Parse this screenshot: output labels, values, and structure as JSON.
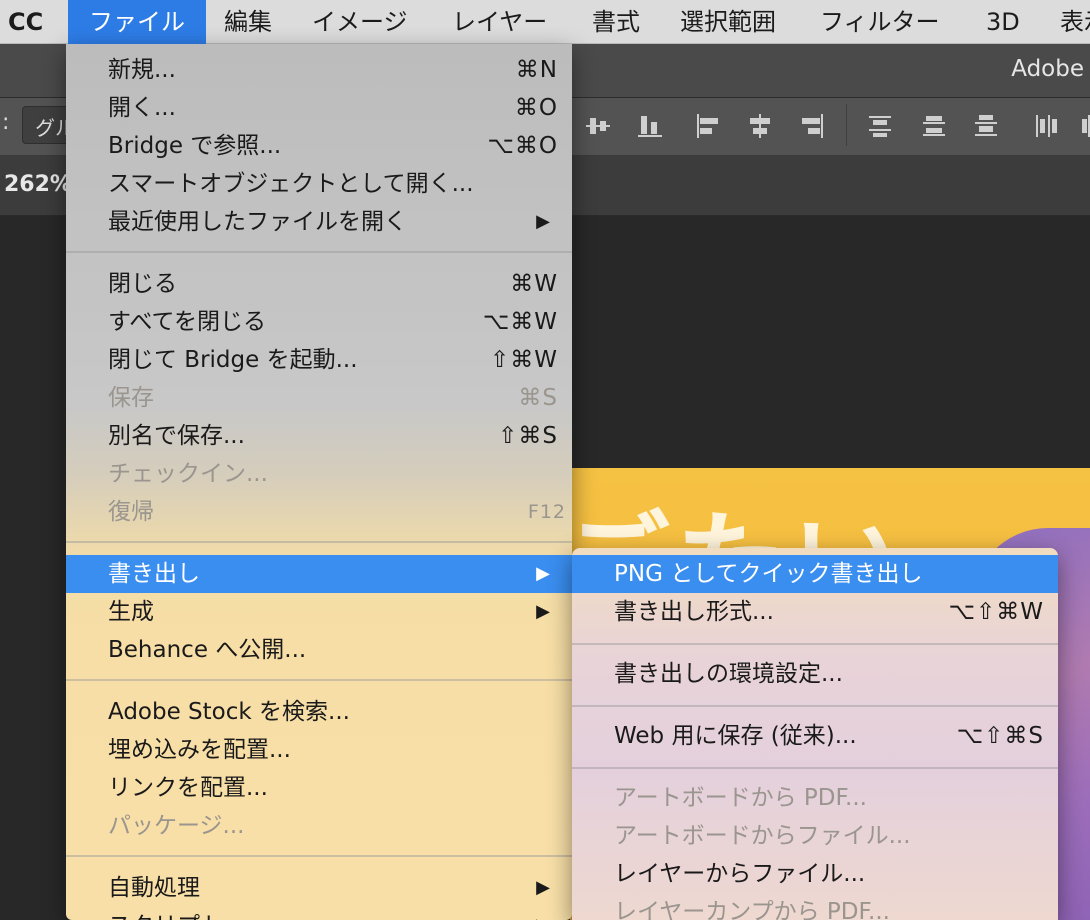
{
  "menubar": {
    "items": [
      "CC",
      "ファイル",
      "編集",
      "イメージ",
      "レイヤー",
      "書式",
      "選択範囲",
      "フィルター",
      "3D",
      "表示"
    ]
  },
  "app": {
    "title": "Adobe"
  },
  "options_bar": {
    "colon": ":",
    "select_value": "グル"
  },
  "tab": {
    "zoom": "262%"
  },
  "artwork": {
    "text": "ごたい"
  },
  "file_menu": {
    "items": [
      {
        "label": "新規...",
        "shortcut": "⌘N"
      },
      {
        "label": "開く...",
        "shortcut": "⌘O"
      },
      {
        "label": "Bridge で参照...",
        "shortcut": "⌥⌘O"
      },
      {
        "label": "スマートオブジェクトとして開く...",
        "shortcut": ""
      },
      {
        "label": "最近使用したファイルを開く",
        "arrow": "▶"
      },
      {
        "label": "閉じる",
        "shortcut": "⌘W"
      },
      {
        "label": "すべてを閉じる",
        "shortcut": "⌥⌘W"
      },
      {
        "label": "閉じて Bridge を起動...",
        "shortcut": "⇧⌘W"
      },
      {
        "label": "保存",
        "shortcut": "⌘S"
      },
      {
        "label": "別名で保存...",
        "shortcut": "⇧⌘S"
      },
      {
        "label": "チェックイン...",
        "shortcut": ""
      },
      {
        "label": "復帰",
        "shortcut": "F12"
      },
      {
        "label": "書き出し",
        "arrow": "▶"
      },
      {
        "label": "生成",
        "arrow": "▶"
      },
      {
        "label": "Behance へ公開...",
        "shortcut": ""
      },
      {
        "label": "Adobe Stock を検索...",
        "shortcut": ""
      },
      {
        "label": "埋め込みを配置...",
        "shortcut": ""
      },
      {
        "label": "リンクを配置...",
        "shortcut": ""
      },
      {
        "label": "パッケージ...",
        "shortcut": ""
      },
      {
        "label": "自動処理",
        "arrow": "▶"
      },
      {
        "label": "スクリプト",
        "arrow": "▶"
      }
    ]
  },
  "export_submenu": {
    "items": [
      {
        "label": "PNG としてクイック書き出し",
        "shortcut": ""
      },
      {
        "label": "書き出し形式...",
        "shortcut": "⌥⇧⌘W"
      },
      {
        "label": "書き出しの環境設定...",
        "shortcut": ""
      },
      {
        "label": "Web 用に保存 (従来)...",
        "shortcut": "⌥⇧⌘S"
      },
      {
        "label": "アートボードから PDF...",
        "shortcut": ""
      },
      {
        "label": "アートボードからファイル...",
        "shortcut": ""
      },
      {
        "label": "レイヤーからファイル...",
        "shortcut": ""
      },
      {
        "label": "レイヤーカンプから PDF...",
        "shortcut": ""
      }
    ]
  },
  "colors": {
    "menu_highlight": "#3a8ef0",
    "menubar_active": "#2d7ce6",
    "artwork_yellow": "#f4bb3d",
    "artwork_purple": "#9c6dba"
  }
}
